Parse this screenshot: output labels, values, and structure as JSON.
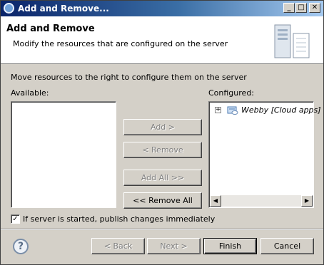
{
  "window": {
    "title": "Add and Remove...",
    "minimize_glyph": "_",
    "maximize_glyph": "□",
    "close_glyph": "✕"
  },
  "banner": {
    "title": "Add and Remove",
    "description": "Modify the resources that are configured on the server",
    "art_icon": "server-wizard-icon"
  },
  "body": {
    "instruction": "Move resources to the right to configure them on the server",
    "available_label": "Available:",
    "configured_label": "Configured:",
    "available_items": [],
    "configured_items": [
      {
        "label": "Webby [Cloud apps]",
        "icon": "cloud-server-icon",
        "expander": "+"
      }
    ]
  },
  "buttons": {
    "add": "Add >",
    "remove": "< Remove",
    "add_all": "Add All >>",
    "remove_all": "<< Remove All",
    "back": "< Back",
    "next": "Next >",
    "finish": "Finish",
    "cancel": "Cancel",
    "help": "?"
  },
  "publish_option": {
    "label": "If server is started, publish changes immediately",
    "checked": true,
    "check_glyph": "✓"
  },
  "scroll": {
    "left_glyph": "◀",
    "right_glyph": "▶"
  }
}
